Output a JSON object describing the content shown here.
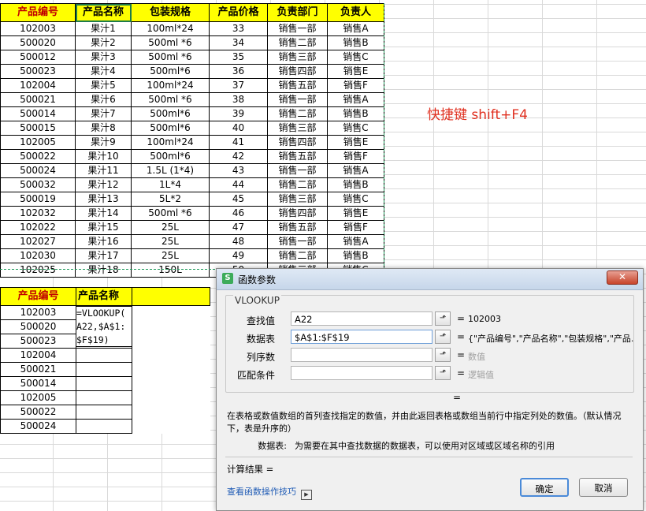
{
  "table1": {
    "headers": [
      "产品编号",
      "产品名称",
      "包装规格",
      "产品价格",
      "负责部门",
      "负责人"
    ],
    "rows": [
      [
        "102003",
        "果汁1",
        "100ml*24",
        "33",
        "销售一部",
        "销售A"
      ],
      [
        "500020",
        "果汁2",
        "500ml *6",
        "34",
        "销售二部",
        "销售B"
      ],
      [
        "500012",
        "果汁3",
        "500ml *6",
        "35",
        "销售三部",
        "销售C"
      ],
      [
        "500023",
        "果汁4",
        "500ml*6",
        "36",
        "销售四部",
        "销售E"
      ],
      [
        "102004",
        "果汁5",
        "100ml*24",
        "37",
        "销售五部",
        "销售F"
      ],
      [
        "500021",
        "果汁6",
        "500ml *6",
        "38",
        "销售一部",
        "销售A"
      ],
      [
        "500014",
        "果汁7",
        "500ml*6",
        "39",
        "销售二部",
        "销售B"
      ],
      [
        "500015",
        "果汁8",
        "500ml*6",
        "40",
        "销售三部",
        "销售C"
      ],
      [
        "102005",
        "果汁9",
        "100ml*24",
        "41",
        "销售四部",
        "销售E"
      ],
      [
        "500022",
        "果汁10",
        "500ml*6",
        "42",
        "销售五部",
        "销售F"
      ],
      [
        "500024",
        "果汁11",
        "1.5L (1*4)",
        "43",
        "销售一部",
        "销售A"
      ],
      [
        "500032",
        "果汁12",
        "1L*4",
        "44",
        "销售二部",
        "销售B"
      ],
      [
        "500019",
        "果汁13",
        "5L*2",
        "45",
        "销售三部",
        "销售C"
      ],
      [
        "102032",
        "果汁14",
        "500ml *6",
        "46",
        "销售四部",
        "销售E"
      ],
      [
        "102022",
        "果汁15",
        "25L",
        "47",
        "销售五部",
        "销售F"
      ],
      [
        "102027",
        "果汁16",
        "25L",
        "48",
        "销售一部",
        "销售A"
      ],
      [
        "102030",
        "果汁17",
        "25L",
        "49",
        "销售二部",
        "销售B"
      ],
      [
        "102025",
        "果汁18",
        "150L",
        "50",
        "销售三部",
        "销售C"
      ]
    ]
  },
  "table2": {
    "headers": [
      "产品编号",
      "产品名称"
    ],
    "ids": [
      "102003",
      "500020",
      "500023",
      "102004",
      "500021",
      "500014",
      "102005",
      "500022",
      "500024"
    ]
  },
  "formula_text": "=VLOOKUP(\nA22,$A$1:\n$F$19)",
  "shortcut_note": "快捷键  shift+F4",
  "dialog": {
    "title": "函数参数",
    "function_name": "VLOOKUP",
    "params": [
      {
        "label": "查找值",
        "value": "A22",
        "result": "102003",
        "dim": false
      },
      {
        "label": "数据表",
        "value": "$A$1:$F$19",
        "result": "{\"产品编号\",\"产品名称\",\"包装规格\",\"产品...",
        "dim": false
      },
      {
        "label": "列序数",
        "value": "",
        "result": "数值",
        "dim": true
      },
      {
        "label": "匹配条件",
        "value": "",
        "result": "逻辑值",
        "dim": true
      }
    ],
    "equals": "=",
    "description": "在表格或数值数组的首列查找指定的数值，并由此返回表格或数组当前行中指定列处的数值。（默认情况下，表是升序的）",
    "param_desc_key": "数据表:",
    "param_desc_text": "为需要在其中查找数据的数据表，可以使用对区域或区域名称的引用",
    "calc_result": "计算结果 =",
    "help_link": "查看函数操作技巧",
    "ok": "确定",
    "cancel": "取消",
    "close_glyph": "✕",
    "app_icon": "S"
  },
  "colors": {
    "header_fill": "#ffff00",
    "header_red": "#c00000",
    "note": "#e03020",
    "link": "#1f5bb5"
  }
}
